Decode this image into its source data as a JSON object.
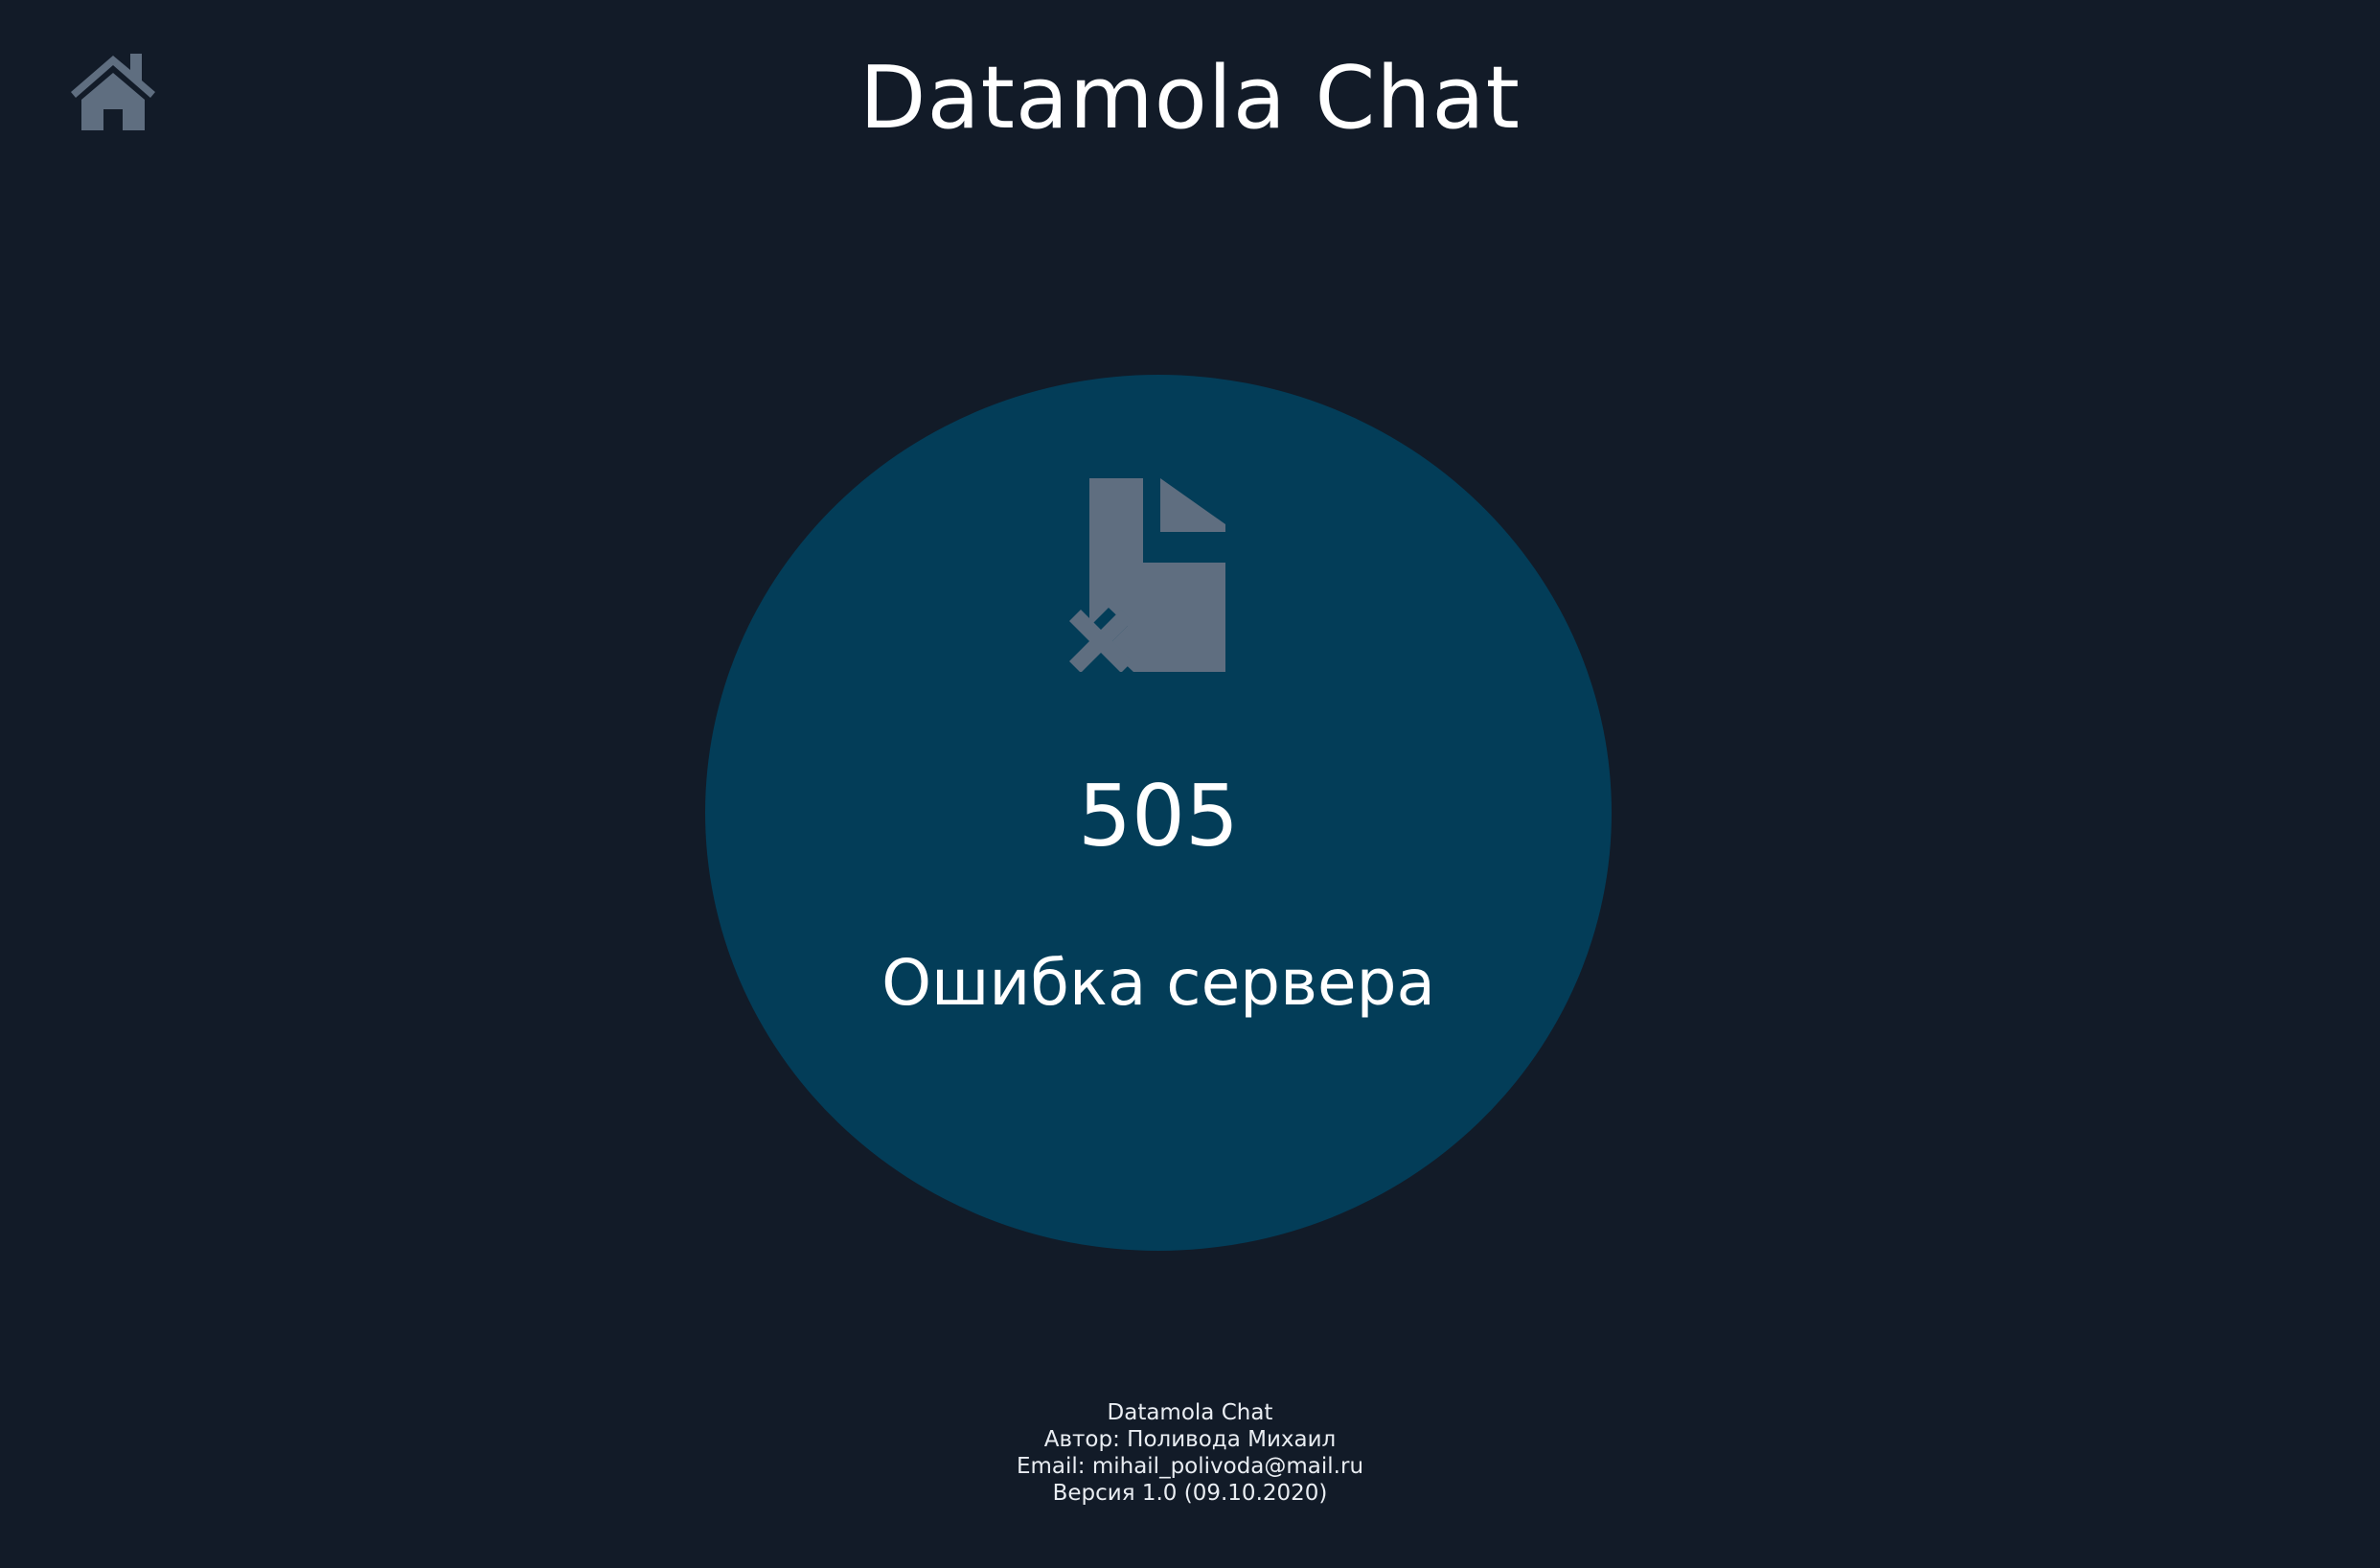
{
  "header": {
    "title": "Datamola Chat",
    "home_icon": "home-icon"
  },
  "error": {
    "icon": "file-error-icon",
    "code": "505",
    "message": "Ошибка сервера"
  },
  "footer": {
    "app_name": "Datamola Chat",
    "author": "Автор: Поливода Михаил",
    "email": "Email: mihail_polivoda@mail.ru",
    "version": "Версия 1.0 (09.10.2020)"
  },
  "colors": {
    "background": "#121b28",
    "circle": "#033d58",
    "icon": "#5f6e80",
    "text": "#ffffff"
  }
}
